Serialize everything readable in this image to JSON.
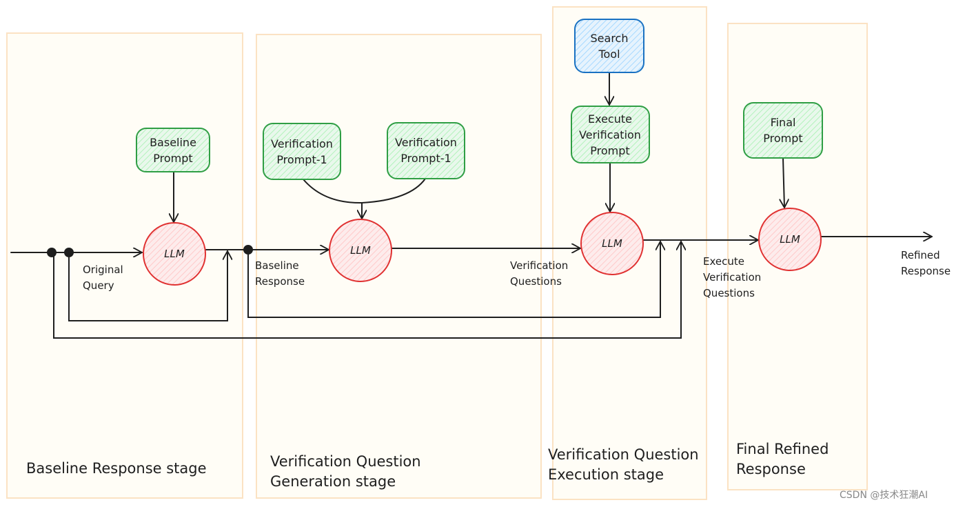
{
  "colors": {
    "panel_fill": "#fffdf6",
    "panel_stroke": "#fbe2c3",
    "prompt_fill": "#b2f2bb",
    "prompt_stroke": "#2f9e44",
    "tool_fill": "#a5d8ff",
    "tool_stroke": "#1971c2",
    "llm_fill": "#ffc9c9",
    "llm_stroke": "#e03131"
  },
  "stages": [
    {
      "lines": [
        "Baseline Response stage"
      ]
    },
    {
      "lines": [
        "Verification Question",
        "Generation stage"
      ]
    },
    {
      "lines": [
        "Verification Question",
        "Execution stage"
      ]
    },
    {
      "lines": [
        "Final Refined",
        "Response"
      ]
    }
  ],
  "nodes": {
    "baseline_prompt": {
      "lines": [
        "Baseline",
        "Prompt"
      ]
    },
    "verification_prompt_a": {
      "lines": [
        "Verification",
        "Prompt-1"
      ]
    },
    "verification_prompt_b": {
      "lines": [
        "Verification",
        "Prompt-1"
      ]
    },
    "search_tool": {
      "lines": [
        "Search",
        "Tool"
      ]
    },
    "execute_verification_prompt": {
      "lines": [
        "Execute",
        "Verification",
        "Prompt"
      ]
    },
    "final_prompt": {
      "lines": [
        "Final",
        "Prompt"
      ]
    },
    "llm_label": "LLM"
  },
  "edge_labels": {
    "original_query": [
      "Original",
      "Query"
    ],
    "baseline_response": [
      "Baseline",
      "Response"
    ],
    "verification_questions": [
      "Verification",
      "Questions"
    ],
    "execute_verification_questions": [
      "Execute",
      "Verification",
      "Questions"
    ],
    "refined_response": [
      "Refined",
      "Response"
    ]
  },
  "watermark": "CSDN @技术狂潮AI"
}
